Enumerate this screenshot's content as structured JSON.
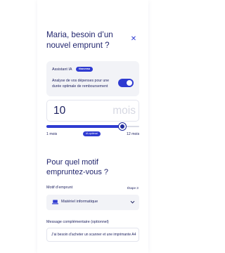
{
  "header": {
    "title": "Maria, besoin d’un nouvel emprunt ?",
    "close_icon": "close-icon"
  },
  "ai_assistant": {
    "label": "Assistant IA",
    "badge": "Nouveau",
    "description": "Analyse de vos dépenses pour une durée optimale de remboursement",
    "toggle_on": true
  },
  "duration": {
    "value": "10",
    "unit": "mois",
    "min_label": "1 mois",
    "max_label": "12 mois",
    "optimal_badge": "IA optimal",
    "min": 1,
    "max": 12,
    "current": 10
  },
  "purpose": {
    "title": "Pour quel motif empruntez-vous ?",
    "field_label": "Motif d’emprunt",
    "step_label": "Étape 3",
    "selected_icon": "laptop-icon",
    "selected_value": "Matériel informatique"
  },
  "message": {
    "label": "Message complémentaire (optionnel)",
    "value": "J’ai besoin d’acheter un scanner et une imprimante A4"
  },
  "colors": {
    "accent": "#2f3bd1",
    "text": "#1b1f5e",
    "card_bg": "#f2f3f7"
  }
}
